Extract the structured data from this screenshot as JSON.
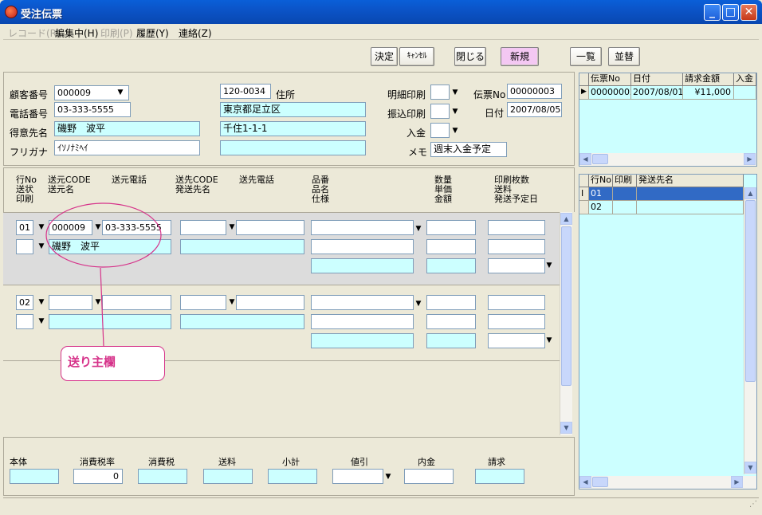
{
  "window": {
    "title": "受注伝票"
  },
  "menu": [
    {
      "label": "レコード(R)",
      "disabled": true
    },
    {
      "label": "編集中(H)",
      "disabled": false
    },
    {
      "label": "印刷(P)",
      "disabled": true
    },
    {
      "label": "履歴(Y)",
      "disabled": false
    },
    {
      "label": "連絡(Z)",
      "disabled": false
    }
  ],
  "toolbar": {
    "decide": "決定",
    "cancel": "ｷｬﾝｾﾙ",
    "close": "閉じる",
    "new": "新規",
    "list": "一覧",
    "sort": "並替"
  },
  "customer": {
    "code_label": "顧客番号",
    "code": "000009",
    "phone_label": "電話番号",
    "phone": "03-333-5555",
    "name_label": "得意先名",
    "name": "磯野　波平",
    "kana_label": "フリガナ",
    "kana": "ｲｿﾉﾅﾐﾍｲ",
    "zip": "120-0034",
    "address_label": "住所",
    "address1": "東京都足立区",
    "address2": "千住1-1-1",
    "address3": ""
  },
  "slip": {
    "detail_print_label": "明細印刷",
    "transfer_print_label": "振込印刷",
    "payment_label": "入金",
    "memo_label": "メモ",
    "memo": "週末入金予定",
    "no_label": "伝票No",
    "no": "00000003",
    "date_label": "日付",
    "date": "2007/08/05"
  },
  "grid_headers": {
    "col1": "行No\n送状\n印刷",
    "col2": "送元CODE\n送元名",
    "col3": "送元電話",
    "col4": "送先CODE\n発送先名",
    "col5": "送先電話",
    "col6": "品番\n品名\n仕様",
    "col7": "数量\n単価\n金額",
    "col8": "印刷枚数\n送料\n発送予定日"
  },
  "rows": [
    {
      "no": "01",
      "sender_code": "000009",
      "sender_phone": "03-333-5555",
      "sender_name": "磯野　波平"
    },
    {
      "no": "02",
      "sender_code": "",
      "sender_phone": "",
      "sender_name": ""
    }
  ],
  "annotation": {
    "label": "送り主欄"
  },
  "totals": {
    "body_label": "本体",
    "tax_rate_label": "消費税率",
    "tax_rate": "0",
    "tax_label": "消費税",
    "shipping_label": "送料",
    "subtotal_label": "小計",
    "discount_label": "値引",
    "deposit_label": "内金",
    "invoice_label": "請求"
  },
  "slip_list": {
    "headers": [
      "伝票No",
      "日付",
      "請求金額",
      "入金"
    ],
    "rows": [
      [
        "00000002",
        "2007/08/01",
        "¥11,000",
        ""
      ]
    ]
  },
  "ship_list": {
    "headers": [
      "行No",
      "印刷",
      "発送先名"
    ],
    "rows": [
      [
        "01",
        "",
        ""
      ],
      [
        "02",
        "",
        ""
      ]
    ]
  },
  "colors": {
    "cyan_field": "#ccffff",
    "new_button": "#f4c8f3",
    "annotation": "#d6338a",
    "titlebar": "#0b54c8"
  },
  "icons": [
    "app-icon",
    "minimize-icon",
    "maximize-icon",
    "close-icon",
    "dropdown-arrow-icon",
    "row-pointer-icon",
    "text-cursor-icon",
    "scroll-up-icon",
    "scroll-down-icon",
    "scroll-left-icon",
    "scroll-right-icon",
    "resize-grip-icon"
  ]
}
